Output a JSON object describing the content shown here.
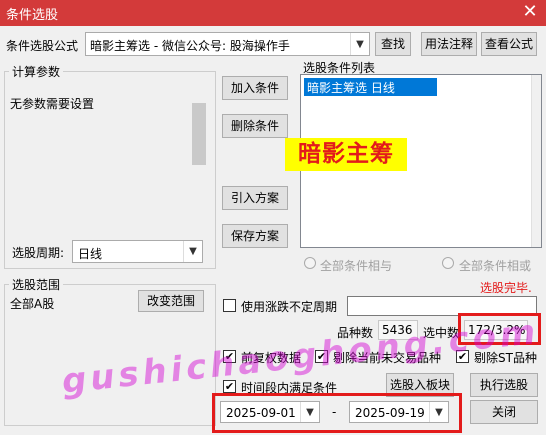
{
  "window": {
    "title": "条件选股",
    "close_glyph": "✕"
  },
  "formula": {
    "label": "条件选股公式",
    "value": "暗影主筹选  -  微信公众号: 股海操作手",
    "find_label": "查找",
    "usage_label": "用法注释",
    "view_label": "查看公式"
  },
  "params": {
    "title": "计算参数",
    "text": "无参数需要设置"
  },
  "period": {
    "label": "选股周期:",
    "value": "日线"
  },
  "buttons": {
    "add": "加入条件",
    "delete": "删除条件",
    "import": "引入方案",
    "save": "保存方案"
  },
  "conditions": {
    "title": "选股条件列表",
    "items": [
      "暗影主筹选  日线"
    ],
    "overlay_text": "暗影主筹"
  },
  "logic": {
    "and_label": "全部条件相与",
    "or_label": "全部条件相或"
  },
  "scope": {
    "title": "选股范围",
    "value": "全部A股",
    "change_label": "改变范围"
  },
  "status": {
    "text": "选股完毕."
  },
  "undetermined": {
    "label": "使用涨跌不定周期",
    "value": ""
  },
  "counts": {
    "total_label": "品种数",
    "total_value": "5436",
    "selected_label": "选中数",
    "selected_value": "172/3.2%"
  },
  "options": {
    "fq_label": "前复权数据",
    "exclude_untraded_label": "剔除当前未交易品种",
    "exclude_st_label": "剔除ST品种",
    "period_label": "时间段内满足条件"
  },
  "actions": {
    "to_block": "选股入板块",
    "execute": "执行选股",
    "close": "关闭"
  },
  "dates": {
    "start": "2025-09-01",
    "separator": "-",
    "end": "2025-09-19"
  },
  "watermark": "gushichaoghong.com",
  "colors": {
    "title_bar": "#d33a3a",
    "highlight": "#0078d7",
    "annotation_red": "#e31b1b",
    "overlay_bg": "#ffff00"
  }
}
